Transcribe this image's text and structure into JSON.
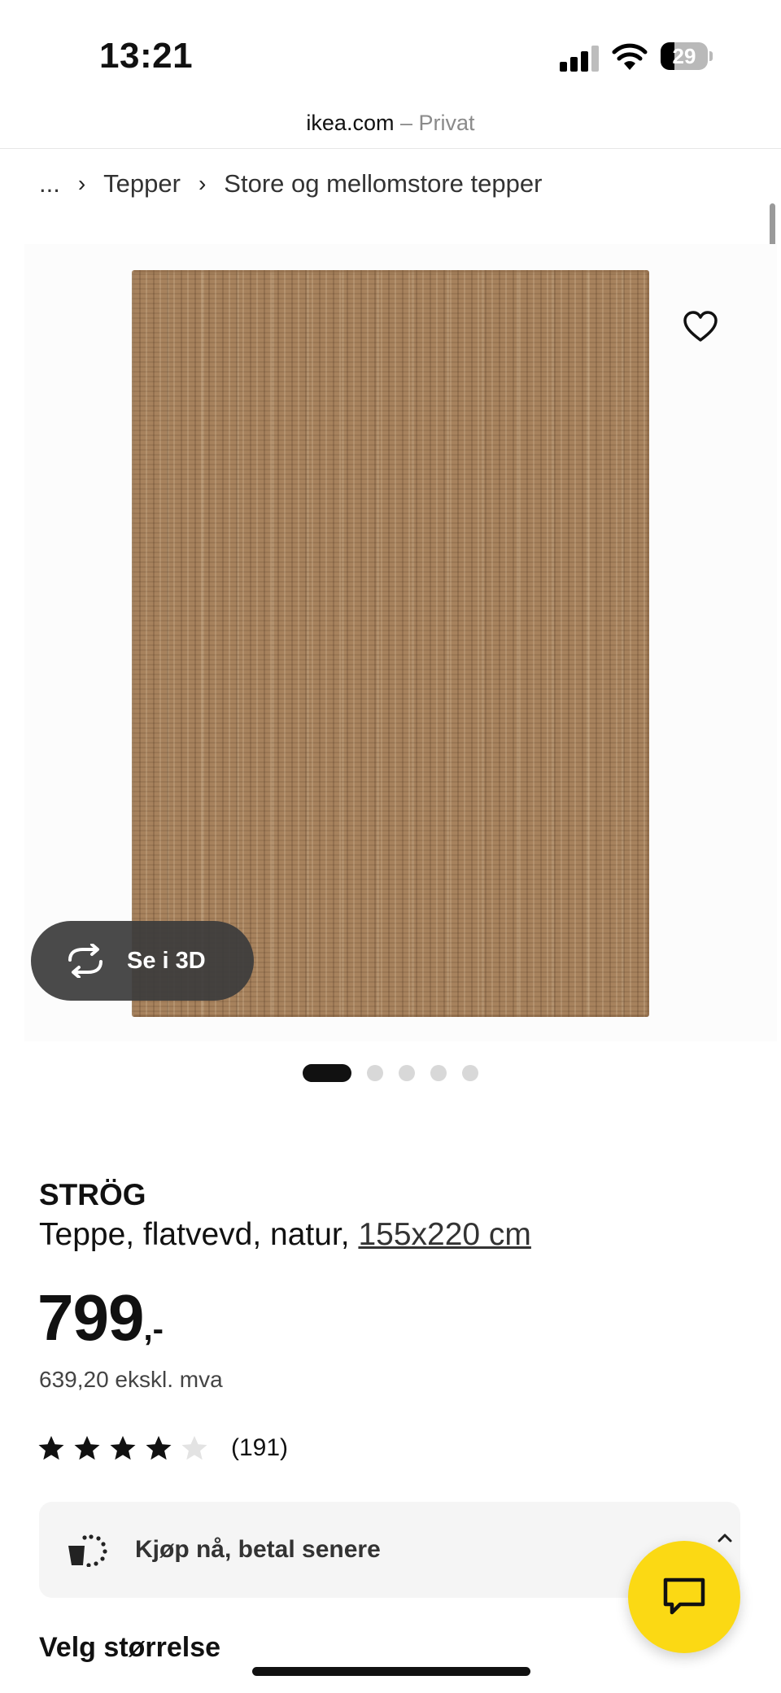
{
  "status_bar": {
    "time": "13:21",
    "battery": "29",
    "battery_level": 0.29
  },
  "browser": {
    "domain": "ikea.com",
    "separator": "–",
    "mode": "Privat"
  },
  "breadcrumb": {
    "ellipsis": "...",
    "items": [
      "Tepper",
      "Store og mellomstore tepper"
    ]
  },
  "gallery": {
    "see_3d_label": "Se i 3D",
    "slide_count": 5,
    "active_slide": 1
  },
  "product": {
    "name": "STRÖG",
    "description": "Teppe, flatvevd, natur,",
    "size": "155x220 cm",
    "price_main": "799",
    "price_suffix": ",-",
    "price_ex_vat": "639,20 ekskl. mva",
    "rating_value": 4,
    "rating_max": 5,
    "review_count": "(191)"
  },
  "pay_later": {
    "label": "Kjøp nå, betal senere"
  },
  "size_section": {
    "heading": "Velg størrelse"
  },
  "colors": {
    "chat_yellow": "#fbd914",
    "rug": "#a7825d",
    "pill_dark": "#3c3c3c"
  },
  "icons": [
    "signal-icon",
    "wifi-icon",
    "battery-icon",
    "heart-icon",
    "rotate-3d-icon",
    "star-icon",
    "pay-later-icon",
    "chat-icon"
  ]
}
